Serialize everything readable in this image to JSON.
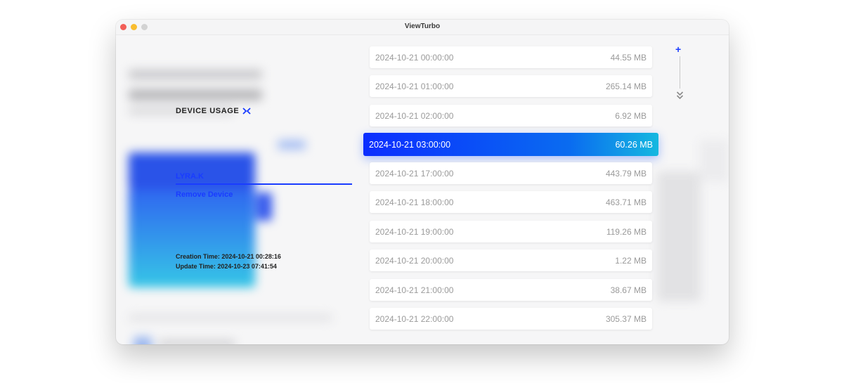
{
  "window": {
    "title": "ViewTurbo"
  },
  "panel": {
    "heading": "DEVICE USAGE",
    "device_name": "LYRA.K",
    "remove_label": "Remove Device",
    "creation_time": "Creation Time: 2024-10-21 00:28:16",
    "update_time": "Update Time: 2024-10-23 07:41:54"
  },
  "usage": [
    {
      "time": "2024-10-21 00:00:00",
      "size": "44.55 MB"
    },
    {
      "time": "2024-10-21 01:00:00",
      "size": "265.14 MB"
    },
    {
      "time": "2024-10-21 02:00:00",
      "size": "6.92 MB"
    },
    {
      "time": "2024-10-21 03:00:00",
      "size": "60.26 MB",
      "selected": true
    },
    {
      "time": "2024-10-21 17:00:00",
      "size": "443.79 MB"
    },
    {
      "time": "2024-10-21 18:00:00",
      "size": "463.71 MB"
    },
    {
      "time": "2024-10-21 19:00:00",
      "size": "119.26 MB"
    },
    {
      "time": "2024-10-21 20:00:00",
      "size": "1.22 MB"
    },
    {
      "time": "2024-10-21 21:00:00",
      "size": "38.67 MB"
    },
    {
      "time": "2024-10-21 22:00:00",
      "size": "305.37 MB"
    }
  ],
  "controls": {
    "plus_icon": "plus-icon",
    "scroll_down_icon": "double-chevron-down-icon"
  },
  "colors": {
    "accent": "#1a3cff",
    "selected_start": "#0b2dff",
    "selected_end": "#15b8e0"
  }
}
